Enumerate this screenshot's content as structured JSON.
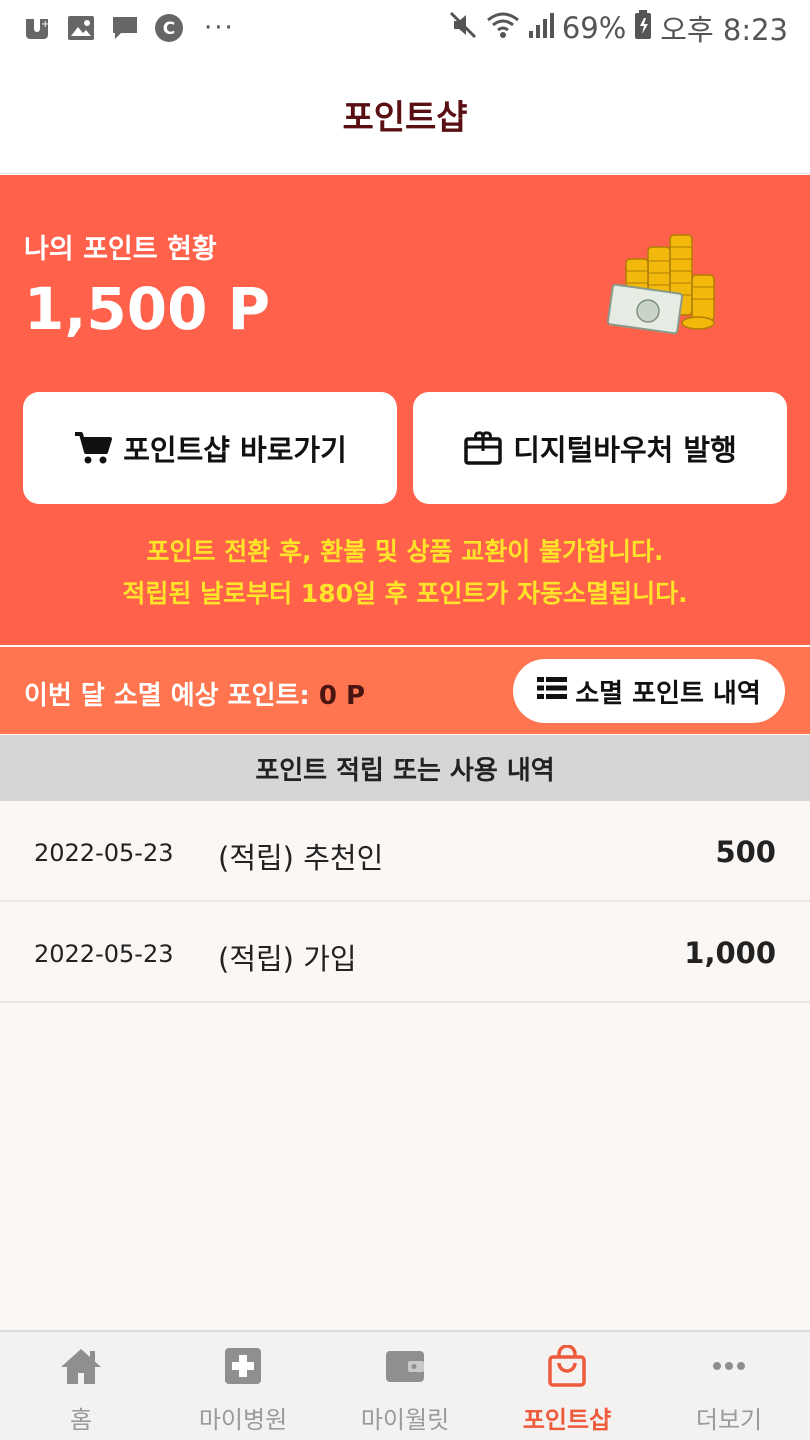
{
  "status_bar": {
    "dots": "···",
    "battery": "69%",
    "time": "오후 8:23",
    "icons": [
      "u-plus-icon",
      "image-icon",
      "message-icon",
      "c-circle-icon",
      "mute-icon",
      "wifi-icon",
      "signal-icon",
      "battery-icon"
    ]
  },
  "header": {
    "title": "포인트샵"
  },
  "summary": {
    "label": "나의 포인트 현황",
    "points": "1,500 P",
    "shop_button": "포인트샵 바로가기",
    "voucher_button": "디지털바우처 발행",
    "notice_line1": "포인트 전환 후, 환불 및 상품 교환이 불가합니다.",
    "notice_line2": "적립된 날로부터 180일 후 포인트가 자동소멸됩니다."
  },
  "expiry": {
    "label": "이번 달 소멸 예상 포인트: ",
    "value": "0 P",
    "button": "소멸 포인트 내역"
  },
  "history": {
    "title": "포인트 적립 또는 사용 내역",
    "rows": [
      {
        "date": "2022-05-23",
        "desc": "(적립) 추천인",
        "amount": "500"
      },
      {
        "date": "2022-05-23",
        "desc": "(적립) 가입",
        "amount": "1,000"
      }
    ]
  },
  "tabs": [
    {
      "label": "홈",
      "icon": "home-icon"
    },
    {
      "label": "마이병원",
      "icon": "hospital-icon"
    },
    {
      "label": "마이월릿",
      "icon": "wallet-icon"
    },
    {
      "label": "포인트샵",
      "icon": "shopping-bag-icon",
      "active": true
    },
    {
      "label": "더보기",
      "icon": "more-icon"
    }
  ],
  "colors": {
    "hero": "#ff614b",
    "expire_bar": "#ff7550",
    "notice": "#ffe32a",
    "active_tab": "#ee5a3c",
    "title": "#5a0f12"
  }
}
